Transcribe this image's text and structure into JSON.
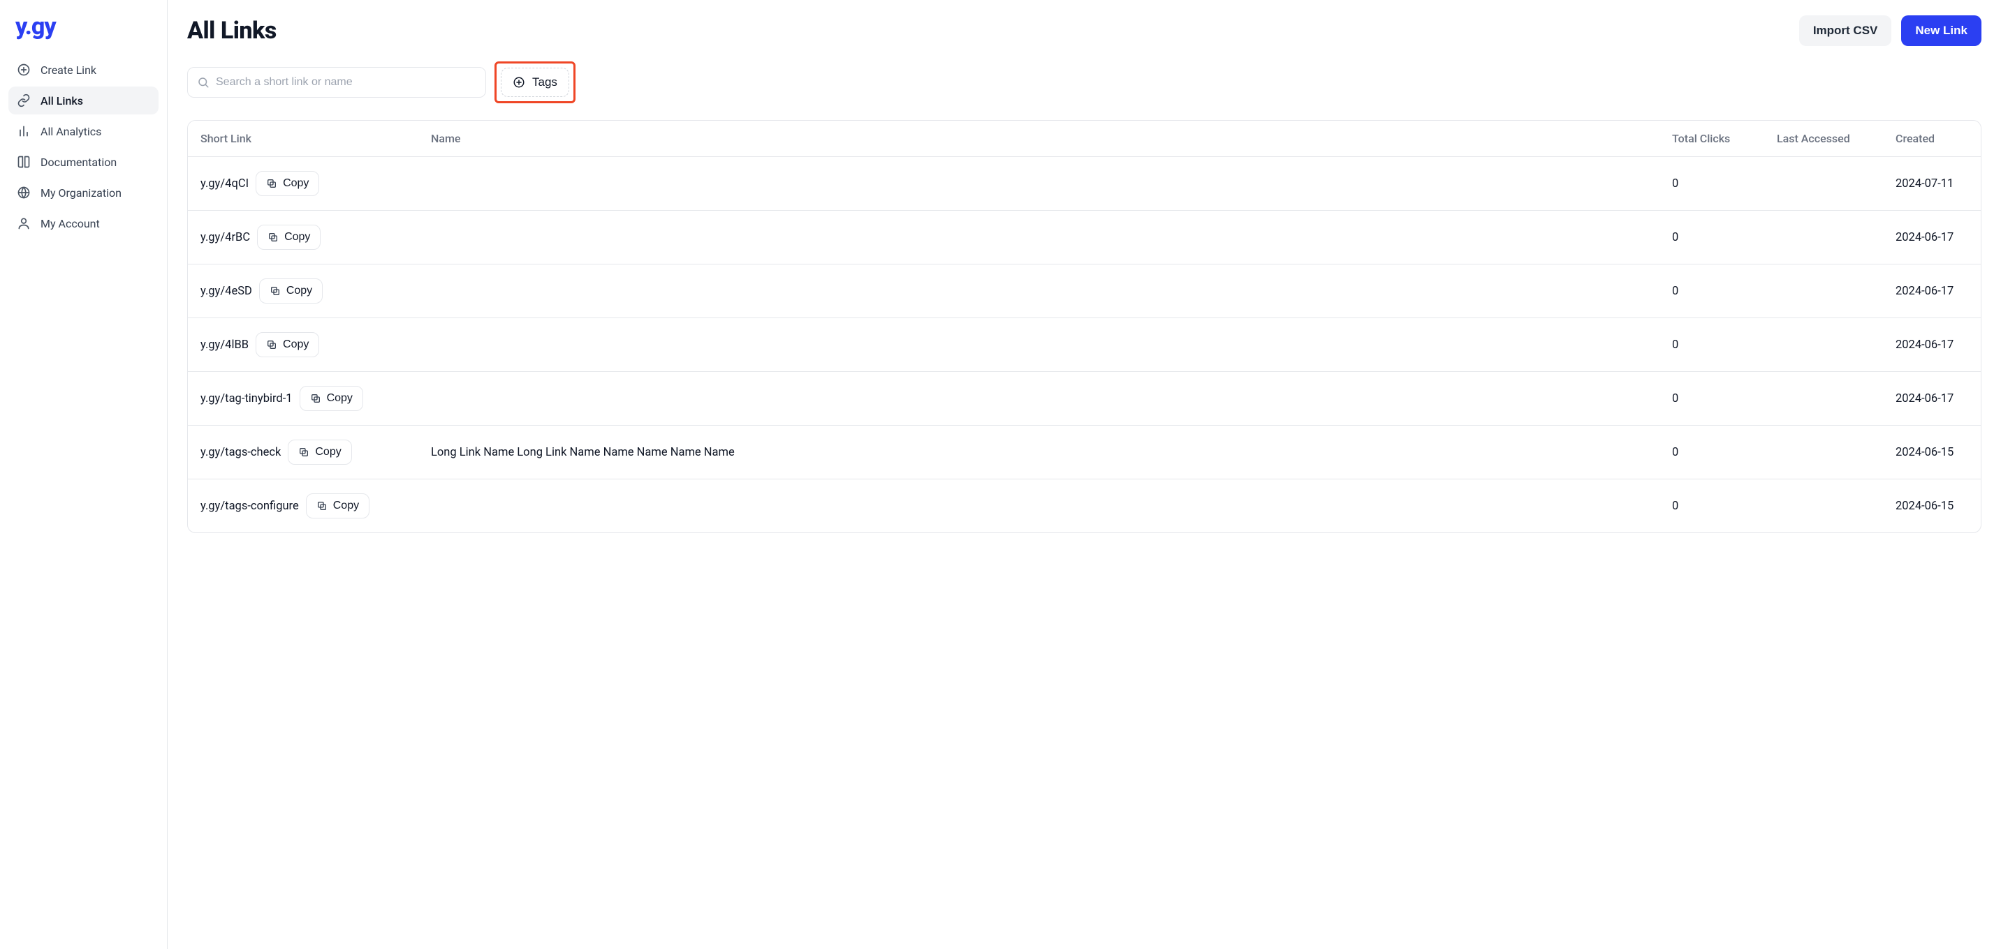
{
  "brand": {
    "logo_text": "y.gy"
  },
  "sidebar": {
    "items": [
      {
        "label": "Create Link",
        "icon": "plus-circle-icon",
        "active": false
      },
      {
        "label": "All Links",
        "icon": "link-icon",
        "active": true
      },
      {
        "label": "All Analytics",
        "icon": "bars-icon",
        "active": false
      },
      {
        "label": "Documentation",
        "icon": "book-icon",
        "active": false
      },
      {
        "label": "My Organization",
        "icon": "globe-icon",
        "active": false
      },
      {
        "label": "My Account",
        "icon": "user-icon",
        "active": false
      }
    ]
  },
  "header": {
    "title": "All Links",
    "import_label": "Import CSV",
    "new_link_label": "New Link"
  },
  "filters": {
    "search_placeholder": "Search a short link or name",
    "tags_label": "Tags"
  },
  "table": {
    "columns": {
      "short_link": "Short Link",
      "name": "Name",
      "total_clicks": "Total Clicks",
      "last_accessed": "Last Accessed",
      "created": "Created"
    },
    "copy_label": "Copy",
    "rows": [
      {
        "short": "y.gy/4qCI",
        "name": "",
        "clicks": "0",
        "last": "",
        "created": "2024-07-11"
      },
      {
        "short": "y.gy/4rBC",
        "name": "",
        "clicks": "0",
        "last": "",
        "created": "2024-06-17"
      },
      {
        "short": "y.gy/4eSD",
        "name": "",
        "clicks": "0",
        "last": "",
        "created": "2024-06-17"
      },
      {
        "short": "y.gy/4lBB",
        "name": "",
        "clicks": "0",
        "last": "",
        "created": "2024-06-17"
      },
      {
        "short": "y.gy/tag-tinybird-1",
        "name": "",
        "clicks": "0",
        "last": "",
        "created": "2024-06-17"
      },
      {
        "short": "y.gy/tags-check",
        "name": "Long Link Name Long Link Name Name Name Name Name",
        "clicks": "0",
        "last": "",
        "created": "2024-06-15"
      },
      {
        "short": "y.gy/tags-configure",
        "name": "",
        "clicks": "0",
        "last": "",
        "created": "2024-06-15"
      }
    ]
  }
}
